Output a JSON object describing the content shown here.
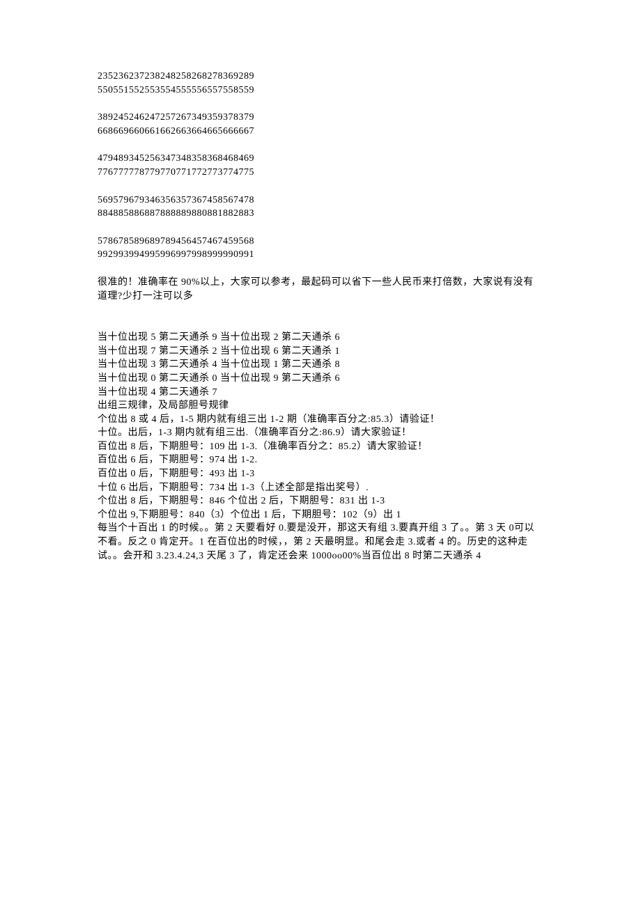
{
  "blocks": [
    {
      "type": "line",
      "text": "235236237238248258268278369289"
    },
    {
      "type": "line",
      "text": "550551552553554555556557558559"
    },
    {
      "type": "blank"
    },
    {
      "type": "line",
      "text": "389245246247257267349359378379"
    },
    {
      "type": "line",
      "text": "668669660661662663664665666667"
    },
    {
      "type": "blank"
    },
    {
      "type": "line",
      "text": "479489345256347348358368468469"
    },
    {
      "type": "line",
      "text": "776777778779770771772773774775"
    },
    {
      "type": "blank"
    },
    {
      "type": "line",
      "text": "569579679346356357367458567478"
    },
    {
      "type": "line",
      "text": "884885886887888889880881882883"
    },
    {
      "type": "blank"
    },
    {
      "type": "line",
      "text": "578678589689789456457467459568"
    },
    {
      "type": "line",
      "text": "992993994995996997998999990991"
    },
    {
      "type": "blank"
    },
    {
      "type": "line",
      "text": "很准的！准确率在 90%以上，大家可以参考，最起码可以省下一些人民币来打倍数，大家说有没有道理?少打一注可以多"
    },
    {
      "type": "big-blank"
    },
    {
      "type": "line",
      "text": "当十位出现 5 第二天通杀 9 当十位出现 2 第二天通杀 6"
    },
    {
      "type": "line",
      "text": "当十位出现 7 第二天通杀 2 当十位出现 6 第二天通杀 1"
    },
    {
      "type": "line",
      "text": "当十位出现 3 第二天通杀 4 当十位出现 1 第二天通杀 8"
    },
    {
      "type": "line",
      "text": "当十位出现 0 第二天通杀 0 当十位出现 9 第二天通杀 6"
    },
    {
      "type": "line",
      "text": "当十位出现 4 第二天通杀 7"
    },
    {
      "type": "line",
      "text": "出组三规律，及局部胆号规律"
    },
    {
      "type": "line",
      "text": "个位出 8 或 4 后，1-5 期内就有组三出 1-2 期（准确率百分之:85.3）请验证！"
    },
    {
      "type": "line",
      "text": "十位。出后，1-3 期内就有组三出.（准确率百分之:86.9）请大家验证！"
    },
    {
      "type": "line",
      "text": "百位出 8 后，下期胆号：109 出 1-3.（准确率百分之：85.2）请大家验证！"
    },
    {
      "type": "line",
      "text": "百位出 6 后，下期胆号：974 出 1-2."
    },
    {
      "type": "line",
      "text": "百位出 0 后，下期胆号：493 出 1-3"
    },
    {
      "type": "line",
      "text": "十位 6 出后，下期胆号：734 出 1-3（上述全部是指出奖号）."
    },
    {
      "type": "line",
      "text": "个位出 8 后，下期胆号：846 个位出 2 后，下期胆号：831 出 1-3"
    },
    {
      "type": "line",
      "text": "个位出 9,下期胆号：840（3）个位出 1 后，下期胆号：102（9）出 1"
    },
    {
      "type": "line",
      "text": "每当个十百出 1 的时候。。第 2 天要看好 0.要是没开，那这天有组 3.要真开组 3 了。。第 3 天 0可以不看。反之 0 肯定开。1 在百位出的时候，，第 2 天最明显。和尾会走 3.或者 4 的。历史的这种走试。。会开和 3.23.4.24,3 天尾 3 了，肯定还会来 1000oo00%当百位出 8 时第二天通杀 4"
    }
  ]
}
